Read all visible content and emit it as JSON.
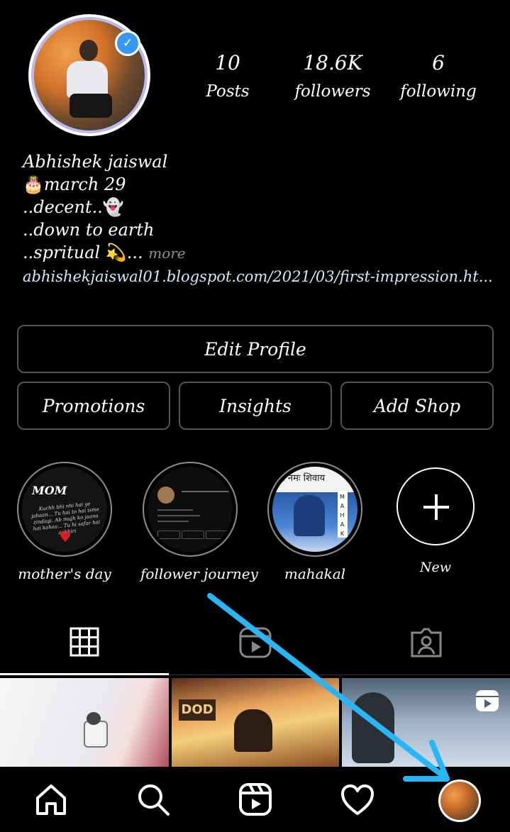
{
  "profile": {
    "avatar_alt": "profile photo",
    "verified_icon": "verified-badge-icon"
  },
  "stats": {
    "posts": {
      "count": "10",
      "label": "Posts"
    },
    "followers": {
      "count": "18.6K",
      "label": "followers"
    },
    "following": {
      "count": "6",
      "label": "following"
    }
  },
  "bio": {
    "name": "Abhishek jaiswal",
    "line1_emoji": "🎂",
    "line1_text": "march 29",
    "line2_text": "..decent..",
    "line2_emoji": "👻",
    "line3_text": "..down to earth",
    "line4_text": "..spritual ",
    "line4_emoji": "💫",
    "line4_ellipsis": "...",
    "more": "more",
    "link": "abhishekjaiswal01.blogspot.com/2021/03/first-impression.ht..."
  },
  "buttons": {
    "edit_profile": "Edit Profile",
    "promotions": "Promotions",
    "insights": "Insights",
    "add_shop": "Add Shop"
  },
  "highlights": [
    {
      "label": "mother's day",
      "cover_title": "MOM",
      "cover_text": "Kuchh bhi nhi hai ye jahaan... Tu hai to hai ismе zindagi. Ab mujh ko jaana hai kahaa... Tu hi safar hai aakhiri"
    },
    {
      "label": "follower journey"
    },
    {
      "label": "mahakal",
      "cover_text": "म नमः शिवाय",
      "cover_letters": [
        "M",
        "A",
        "H",
        "A",
        "K"
      ]
    },
    {
      "label": "New"
    }
  ],
  "tabs": [
    {
      "name": "grid",
      "icon": "grid-icon",
      "active": true
    },
    {
      "name": "reels",
      "icon": "reels-icon",
      "active": false
    },
    {
      "name": "tagged",
      "icon": "tagged-icon",
      "active": false
    }
  ],
  "nav": {
    "icons": [
      "home-icon",
      "search-icon",
      "reels-icon",
      "heart-icon",
      "profile-avatar"
    ]
  },
  "colors": {
    "background": "#000000",
    "verified": "#3897f0",
    "annotation_arrow": "#29b6f6",
    "link": "#d6e7ff"
  }
}
